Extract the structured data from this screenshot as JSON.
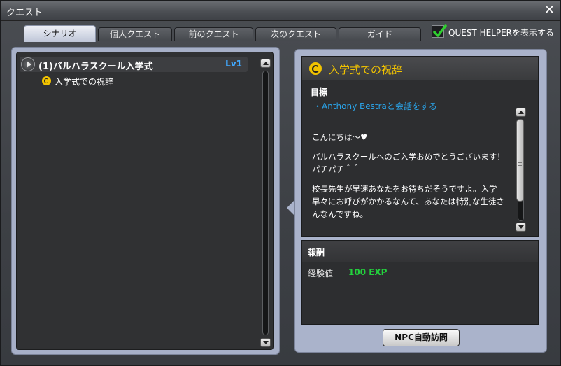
{
  "window": {
    "title": "クエスト"
  },
  "tabs": [
    {
      "label": "シナリオ",
      "active": true
    },
    {
      "label": "個人クエスト"
    },
    {
      "label": "前のクエスト"
    },
    {
      "label": "次のクエスト"
    },
    {
      "label": "ガイド"
    }
  ],
  "helper": {
    "label": "QUEST HELPERを表示する",
    "checked": true
  },
  "quest_list": {
    "category": {
      "title": "(1)バルハラスクール入学式",
      "level": "Lv1"
    },
    "items": [
      {
        "label": "入学式での祝辞"
      }
    ]
  },
  "quest_detail": {
    "title": "入学式での祝辞",
    "objective_label": "目標",
    "objective": "・Anthony Bestraと会話をする",
    "description": [
      "こんにちは～♥",
      "バルハラスクールへのご入学おめでとうございます！パチパチ＾＾",
      "校長先生が早速あなたをお待ちだそうですよ。入学早々にお呼びがかかるなんて、あなたは特別な生徒さんなんですね。"
    ]
  },
  "reward": {
    "label": "報酬",
    "exp_label": "経験値",
    "exp_value": "100 EXP"
  },
  "npc_button": {
    "label": "NPC自動訪問"
  },
  "colors": {
    "accent_quest": "#f2c300",
    "objective_link": "#2aa3e8",
    "exp": "#23d23d",
    "level": "#41a9ff"
  },
  "icons": {
    "close": "close-icon",
    "check": "checkmark-icon",
    "quest": "quest-icon",
    "expand": "play-icon"
  }
}
